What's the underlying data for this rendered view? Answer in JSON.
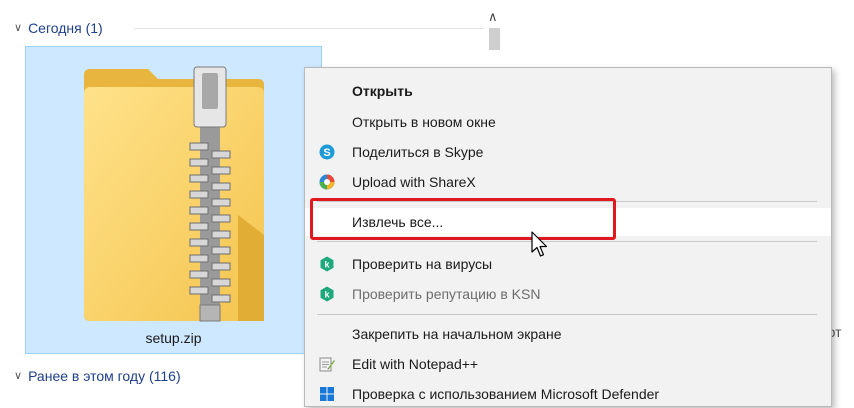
{
  "groups": {
    "today": {
      "label": "Сегодня (1)"
    },
    "earlier": {
      "label": "Ранее в этом году (116)"
    }
  },
  "file": {
    "name": "setup.zip",
    "icon": "zip-folder-icon"
  },
  "trailing_text": "мот",
  "context_menu": {
    "items": [
      {
        "label": "Открыть",
        "bold": true
      },
      {
        "label": "Открыть в новом окне"
      },
      {
        "label": "Поделиться в Skype",
        "icon": "skype-icon"
      },
      {
        "label": "Upload with ShareX",
        "icon": "sharex-icon"
      },
      {
        "label": "Извлечь все...",
        "highlighted": true
      },
      {
        "label": "Проверить на вирусы",
        "icon": "kaspersky-icon"
      },
      {
        "label": "Проверить репутацию в KSN",
        "icon": "kaspersky-icon",
        "disabled": true
      },
      {
        "label": "Закрепить на начальном экране"
      },
      {
        "label": "Edit with Notepad++",
        "icon": "notepadpp-icon"
      },
      {
        "label": "Проверка с использованием Microsoft Defender",
        "icon": "defender-icon"
      }
    ]
  },
  "colors": {
    "selection_fill": "#cde8ff",
    "selection_border": "#99d1ff",
    "highlight_box": "#e0181f",
    "header_text": "#1e3f8a"
  }
}
